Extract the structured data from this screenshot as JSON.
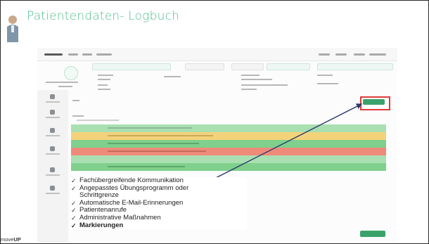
{
  "slide": {
    "title": "Patientendaten- Logbuch",
    "brand_prefix": "move",
    "brand_suffix": "UP"
  },
  "features": [
    {
      "label": "Fachübergreifende Kommunikation",
      "bold": false
    },
    {
      "label": "Angepasstes Übungsprogramm oder",
      "bold": false
    },
    {
      "label": "Schrittgrenze",
      "bold": false,
      "continuation": true
    },
    {
      "label": "Automatische E-Mail-Erinnerungen",
      "bold": false
    },
    {
      "label": "Patientenanrufe",
      "bold": false
    },
    {
      "label": "Administrative Maßnahmen",
      "bold": false
    },
    {
      "label": "Markierungen",
      "bold": true
    }
  ],
  "check_glyph": "✓",
  "colors": {
    "title": "#4fbf8d",
    "highlight": "#e03b3b",
    "band_yellow": "#f3d27a",
    "band_green": "#7fd08c",
    "band_red": "#ee8a7a"
  }
}
